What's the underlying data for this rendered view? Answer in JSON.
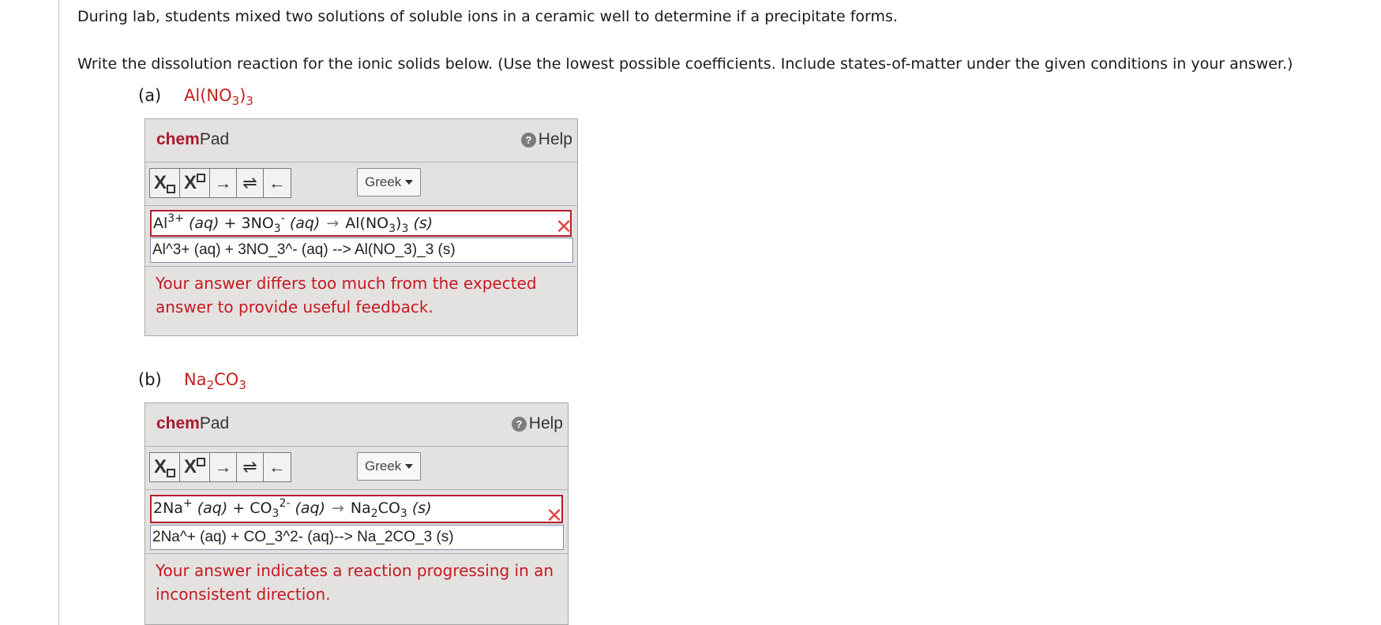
{
  "intro": "During lab, students mixed two solutions of soluble ions in a ceramic well to determine if a precipitate forms.",
  "instructions": "Write the dissolution reaction for the ionic solids below. (Use the lowest possible coefficients. Include states-of-matter under the given conditions in your answer.)",
  "parts": [
    {
      "letter": "(a)",
      "formula": {
        "f1": "Al(NO",
        "s1": "3",
        "f2": ")",
        "s2": "3",
        "f3": ""
      },
      "chempad": {
        "title_bold": "chem",
        "title_rest": "Pad",
        "help_label": "Help",
        "greek_label": "Greek",
        "rendered": {
          "p1": "Al",
          "p1_sup": "3+",
          "p1_state": "(aq)",
          "plus": "+",
          "p2": "3NO",
          "p2_sub": "3",
          "p2_sup": "-",
          "p2_state": "(aq)",
          "arrow": "→",
          "prod": "Al(NO",
          "prod_sub1": "3",
          "prod_mid": ")",
          "prod_sub2": "3",
          "prod_state": "(s)"
        },
        "raw_input": "Al^3+ (aq) + 3NO_3^- (aq) --> Al(NO_3)_3 (s)",
        "feedback": "Your answer differs too much from the expected answer to provide useful feedback."
      }
    },
    {
      "letter": "(b)",
      "formula": {
        "f1": "Na",
        "s1": "2",
        "f2": "CO",
        "s2": "3",
        "f3": ""
      },
      "chempad": {
        "title_bold": "chem",
        "title_rest": "Pad",
        "help_label": "Help",
        "greek_label": "Greek",
        "rendered": {
          "p1": "2Na",
          "p1_sup": "+",
          "p1_state": "(aq)",
          "plus": "+",
          "p2": "CO",
          "p2_sub": "3",
          "p2_sup": "2-",
          "p2_state": "(aq)",
          "arrow": "→",
          "prod": "Na",
          "prod_sub1": "2",
          "prod_mid": "CO",
          "prod_sub2": "3",
          "prod_state": "(s)"
        },
        "raw_input": "2Na^+ (aq) + CO_3^2- (aq)--> Na_2CO_3 (s)",
        "feedback": "Your answer indicates a reaction progressing in an inconsistent direction."
      }
    }
  ],
  "toolbar_buttons": {
    "subscript": "X",
    "superscript": "X",
    "arrow_right": "→",
    "arrow_equilibrium": "⇌",
    "arrow_left": "←"
  },
  "icons": {
    "help": "?",
    "wrong": "✕"
  },
  "colors": {
    "formula_red": "#c3211f",
    "feedback_red": "#c6191f",
    "chem_brand": "#a8192d",
    "error_border": "#b3202c"
  }
}
